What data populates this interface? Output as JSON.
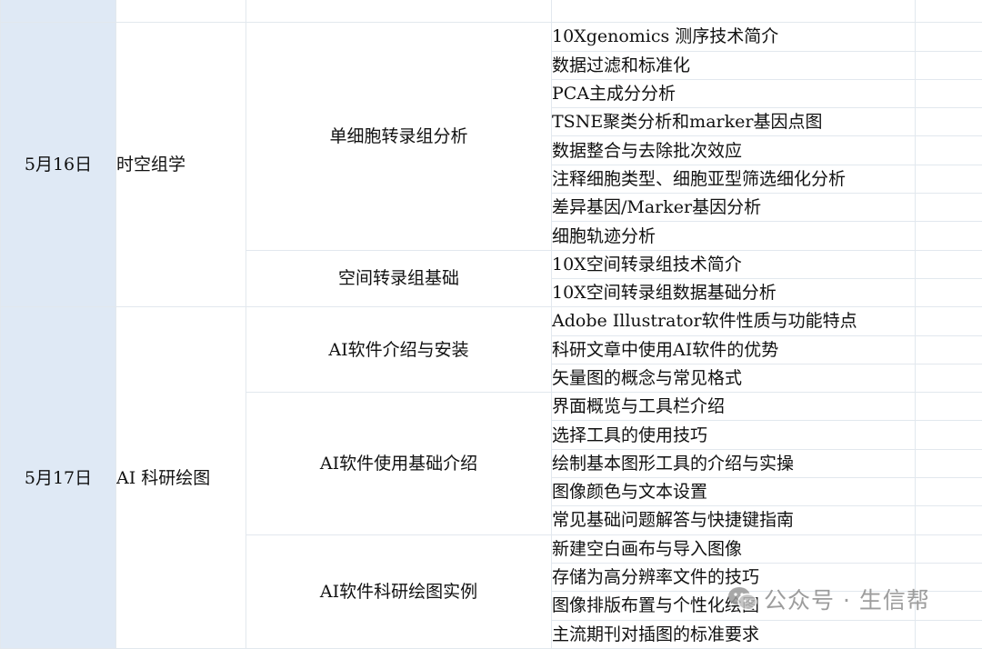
{
  "schedule": {
    "days": [
      {
        "date": "5月16日",
        "topic": "时空组学",
        "modules": [
          {
            "title": "单细胞转录组分析",
            "items": [
              "10Xgenomics 测序技术简介",
              "数据过滤和标准化",
              "PCA主成分分析",
              "TSNE聚类分析和marker基因点图",
              "数据整合与去除批次效应",
              "注释细胞类型、细胞亚型筛选细化分析",
              "差异基因/Marker基因分析",
              "细胞轨迹分析"
            ]
          },
          {
            "title": "空间转录组基础",
            "items": [
              "10X空间转录组技术简介",
              "10X空间转录组数据基础分析"
            ]
          }
        ]
      },
      {
        "date": "5月17日",
        "topic": "AI 科研绘图",
        "modules": [
          {
            "title": "AI软件介绍与安装",
            "items": [
              "Adobe Illustrator软件性质与功能特点",
              "科研文章中使用AI软件的优势",
              "矢量图的概念与常见格式"
            ]
          },
          {
            "title": "AI软件使用基础介绍",
            "items": [
              "界面概览与工具栏介绍",
              "选择工具的使用技巧",
              "绘制基本图形工具的介绍与实操",
              "图像颜色与文本设置",
              "常见基础问题解答与快捷键指南"
            ]
          },
          {
            "title": "AI软件科研绘图实例",
            "items": [
              "新建空白画布与导入图像",
              "存储为高分辨率文件的技巧",
              "图像排版布置与个性化绘图",
              "主流期刊对插图的标准要求"
            ]
          }
        ]
      }
    ]
  },
  "watermark": {
    "text": "公众号 · 生信帮",
    "icon": "wechat-icon"
  },
  "colors": {
    "date_column_bg": "#dfe9f5",
    "grid_line": "#e2e8ee"
  }
}
